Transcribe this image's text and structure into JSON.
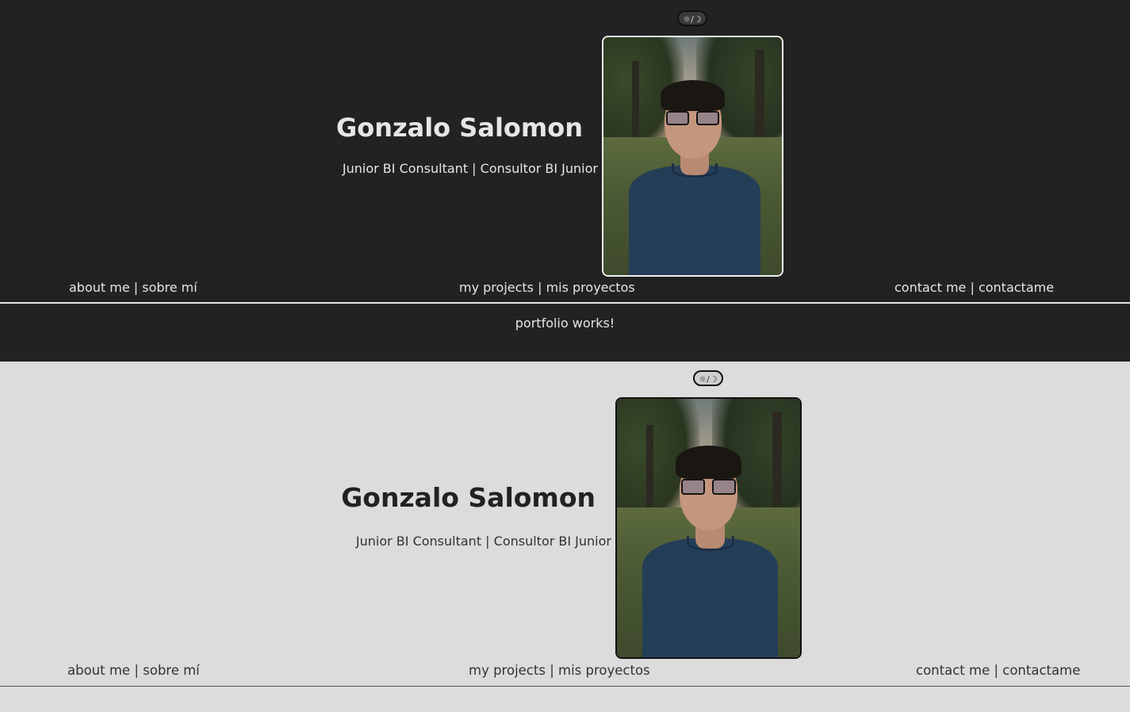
{
  "dark_view": {
    "theme_toggle": "☼/☽",
    "name": "Gonzalo Salomon",
    "subtitle": "Junior BI Consultant | Consultor BI Junior",
    "nav": {
      "about": "about me | sobre mí",
      "projects": "my projects | mis proyectos",
      "contact": "contact me | contactame"
    },
    "footer_text": "portfolio works!"
  },
  "light_view": {
    "theme_toggle": "☼/☽",
    "name": "Gonzalo Salomon",
    "subtitle": "Junior BI Consultant | Consultor BI Junior",
    "nav": {
      "about": "about me | sobre mí",
      "projects": "my projects | mis proyectos",
      "contact": "contact me | contactame"
    }
  },
  "colors": {
    "dark_background": "#222222",
    "light_background": "#dcdcdc",
    "dark_text": "#e6e6e6",
    "light_text": "#2a2a2a"
  },
  "icons": {
    "theme_toggle": "sun-moon-icon"
  }
}
